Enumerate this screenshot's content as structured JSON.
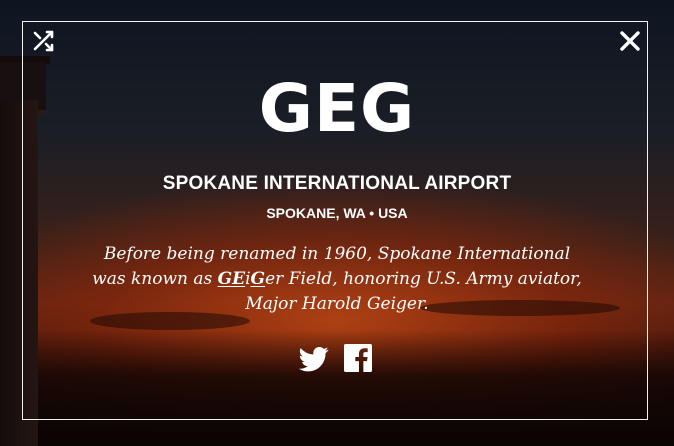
{
  "controls": {
    "shuffle_icon": "shuffle-icon",
    "close_icon": "close-icon"
  },
  "airport": {
    "code": "GEG",
    "name": "SPOKANE INTERNATIONAL AIRPORT",
    "location": "SPOKANE, WA • USA"
  },
  "fact": {
    "part1": "Before being renamed in 1960, Spokane International was known as ",
    "ge": "GE",
    "i": "i",
    "g": "G",
    "part2": "er Field, honoring U.S. Army aviator, Major Harold Geiger."
  },
  "social": {
    "twitter_icon": "twitter-icon",
    "facebook_icon": "facebook-icon"
  },
  "colors": {
    "text": "#ffffff",
    "sky_top": "#0e1521",
    "sunset": "#be4614"
  }
}
